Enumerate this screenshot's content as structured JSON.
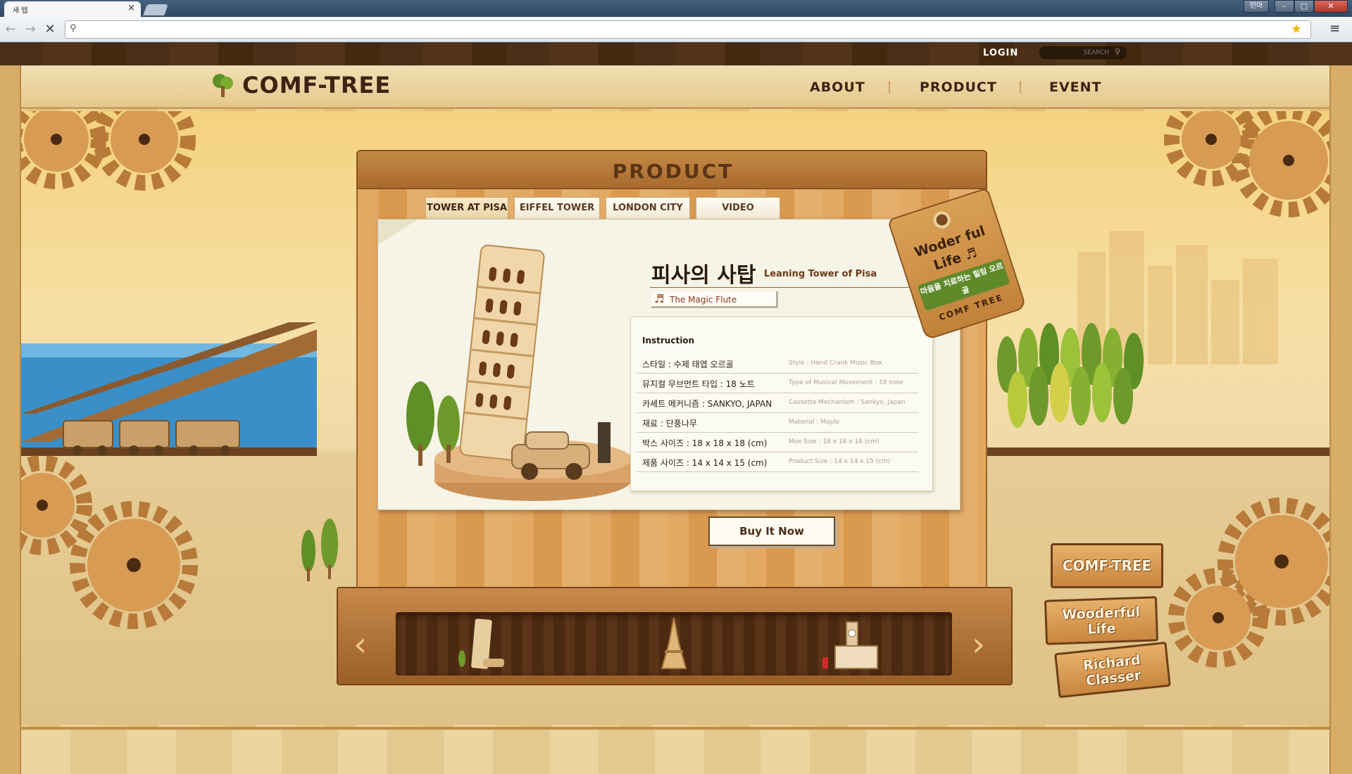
{
  "browser": {
    "tab_title": "새 탭",
    "tab_close": "×",
    "window_lang": "민아",
    "window_min": "–",
    "window_max": "▢",
    "window_close": "✕",
    "url_value": ""
  },
  "site": {
    "logo": "COMF-TREE",
    "login": "LOGIN",
    "search_placeholder": "SEARCH",
    "nav": [
      "ABOUT",
      "PRODUCT",
      "EVENT"
    ]
  },
  "board": {
    "title": "PRODUCT",
    "tabs": [
      "TOWER AT PISA",
      "EIFFEL TOWER",
      "LONDON CITY",
      "VIDEO"
    ],
    "active_tab": "TOWER AT PISA"
  },
  "product": {
    "title_ko": "피사의 사탑",
    "title_en": "Leaning Tower of Pisa",
    "song": "The Magic Flute",
    "instruction_title": "Instruction",
    "specs": [
      {
        "ko": "스타일 : 수제 태엽 오르골",
        "en": "Style : Hand Crank Music Box"
      },
      {
        "ko": "뮤지컬 무브먼트 타입 : 18 노트",
        "en": "Type of Musical Movement : 18 note"
      },
      {
        "ko": "카세트 메커니즘 : SANKYO, JAPAN",
        "en": "Cassette Mechanism : Sankyo, Japan"
      },
      {
        "ko": "재료 : 단풍나무",
        "en": "Material : Maple"
      },
      {
        "ko": "박스 사이즈 : 18 x 18 x 18 (cm)",
        "en": "Mox Size : 18 x 18 x 18 (cm)"
      },
      {
        "ko": "제품 사이즈 : 14 x 14 x 15 (cm)",
        "en": "Product Size : 14 x 14 x 15 (cm)"
      }
    ],
    "buy_label": "Buy It Now"
  },
  "tag": {
    "line1": "Woder ful",
    "line2": "Life ♬",
    "ribbon": "마음을 치료하는 힐링 오르골",
    "line3": "COMF TREE"
  },
  "side_signs": [
    "COMF-TREE",
    "Wooderful Life",
    "Richard Classer"
  ],
  "icons": {
    "search": "search-icon",
    "star": "star-icon",
    "menu": "menu-icon",
    "note": "music-note-icon",
    "arrow_left": "chevron-left-icon",
    "arrow_right": "chevron-right-icon"
  }
}
